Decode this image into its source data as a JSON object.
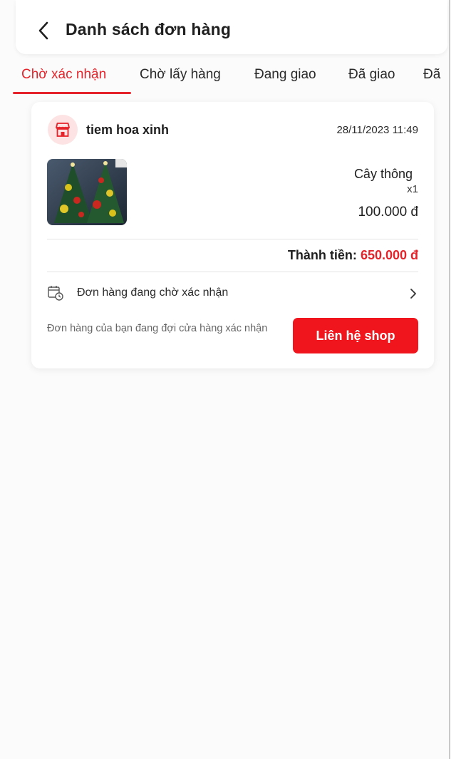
{
  "header": {
    "back_icon": "chevron-left-icon",
    "title": "Danh sách đơn hàng"
  },
  "tabs": [
    {
      "label": "Chờ xác nhận",
      "active": true
    },
    {
      "label": "Chờ lấy hàng",
      "active": false
    },
    {
      "label": "Đang giao",
      "active": false
    },
    {
      "label": "Đã giao",
      "active": false
    },
    {
      "label": "Đã",
      "active": false
    }
  ],
  "order": {
    "shop_icon": "store-icon",
    "shop_name": "tiem hoa xinh",
    "date": "28/11/2023 11:49",
    "product": {
      "name": "Cây thông",
      "quantity": "x1",
      "price": "100.000 đ"
    },
    "total_label": "Thành tiền:",
    "total_value": "650.000 đ",
    "status_icon": "clock-calendar-icon",
    "status_text": "Đơn hàng đang chờ xác nhận",
    "waiting_note": "Đơn hàng của bạn đang đợi cửa hàng xác nhận",
    "contact_button": "Liên hệ shop"
  },
  "colors": {
    "accent": "#e5232a",
    "button": "#f0151c",
    "avatar_bg": "#fde3e3"
  }
}
